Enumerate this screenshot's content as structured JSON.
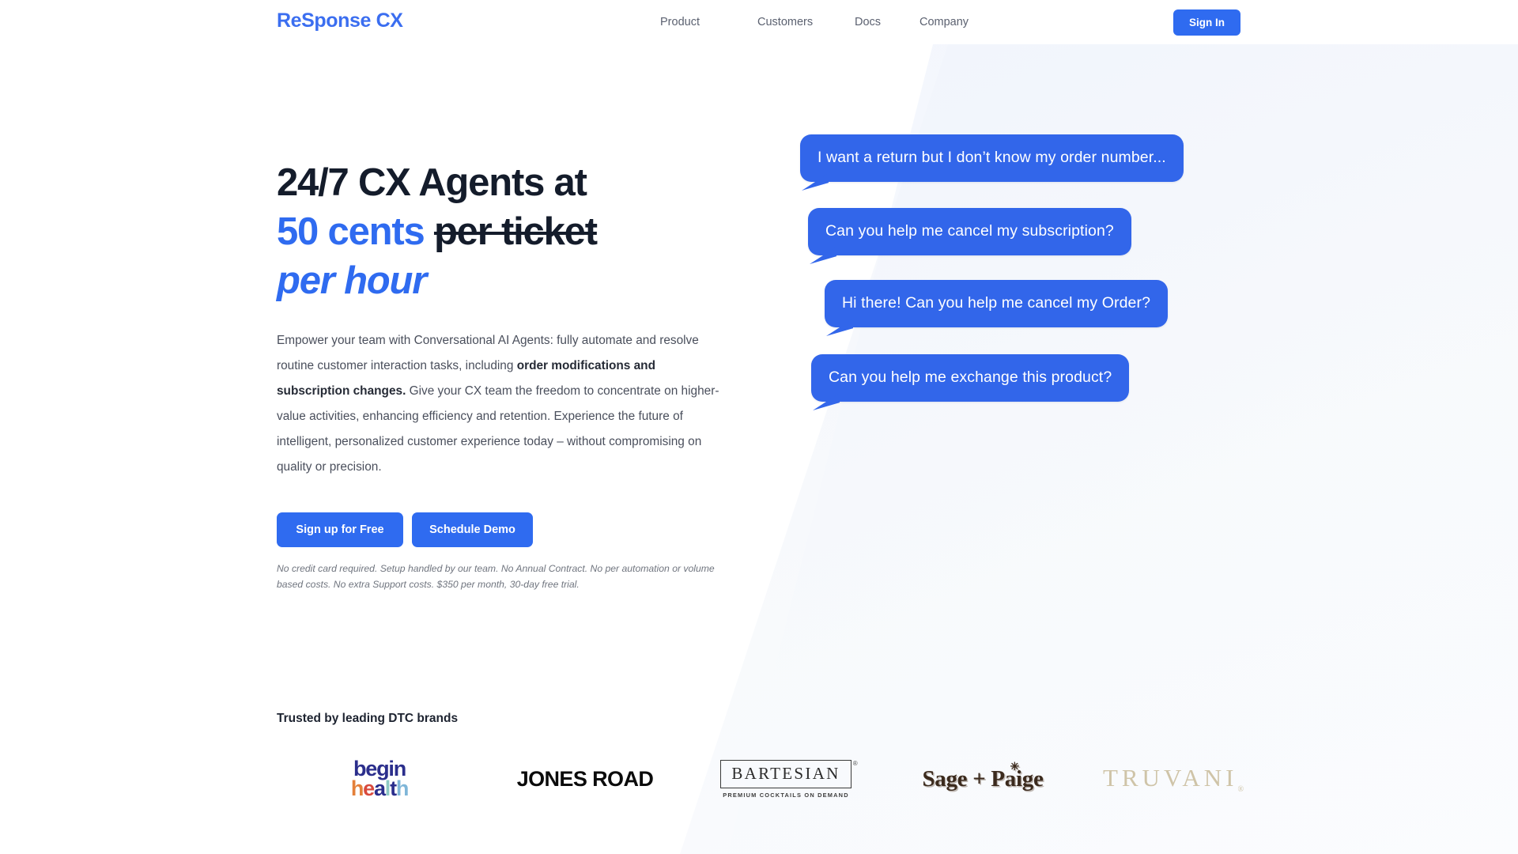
{
  "header": {
    "logo": "ReSponse CX",
    "nav": [
      {
        "label": "Product"
      },
      {
        "label": "Customers"
      },
      {
        "label": "Docs"
      },
      {
        "label": "Company"
      }
    ],
    "signin_label": "Sign In"
  },
  "hero": {
    "headline": {
      "line1": "24/7 CX Agents at",
      "line2_blue": "50 cents",
      "line2_strike": "per ticket",
      "line3_italic": "per hour"
    },
    "body": {
      "part1": "Empower your team with Conversational AI Agents: fully automate and resolve routine customer interaction tasks, including ",
      "bold": "order modifications and subscription changes.",
      "part2": " Give your CX team the freedom to concentrate on higher-value activities, enhancing efficiency and retention. Experience the future of intelligent, personalized customer experience today – without compromising on quality or precision."
    },
    "cta": {
      "primary": "Sign up for Free",
      "secondary": "Schedule Demo"
    },
    "fineprint": "No credit card required. Setup handled by our team. No Annual Contract. No per automation or volume based costs. No extra Support costs. $350 per month, 30-day free trial."
  },
  "chat_bubbles": [
    {
      "text": "I want a return but I don’t know my order number..."
    },
    {
      "text": "Can you help me cancel my subscription?"
    },
    {
      "text": "Hi there! Can you help me cancel my Order?"
    },
    {
      "text": "Can you help me exchange this product?"
    }
  ],
  "trusted": {
    "title": "Trusted by leading DTC brands",
    "logos": [
      {
        "name": "begin health",
        "line1": "begin",
        "line2": "health",
        "line1_colors": [
          "#2b2e8c",
          "#2b2e8c",
          "#2b2e8c",
          "#2b2e8c",
          "#2b2e8c"
        ],
        "line2_colors": [
          "#e4803a",
          "#d94a3d",
          "#2b2e8c",
          "#8dc9c4",
          "#2b2e8c",
          "#7fb6d8"
        ]
      },
      {
        "name": "JONES ROAD",
        "text": "JONES ROAD"
      },
      {
        "name": "BARTESIAN",
        "text": "BARTESIAN",
        "subtitle": "PREMIUM COCKTAILS ON DEMAND",
        "registered": "®",
        "trademark": "™"
      },
      {
        "name": "Sage + Paige",
        "text": "Sage + Paige",
        "star": "✳"
      },
      {
        "name": "TRUVANI",
        "text": "TRUVANI",
        "registered": "®"
      }
    ]
  },
  "colors": {
    "brand_blue": "#2f6bf0",
    "bubble_blue": "#3266ea",
    "headline_dark": "#141c2b",
    "body_gray": "#4a4f5c",
    "panel_tint": "#f4f6fb"
  }
}
